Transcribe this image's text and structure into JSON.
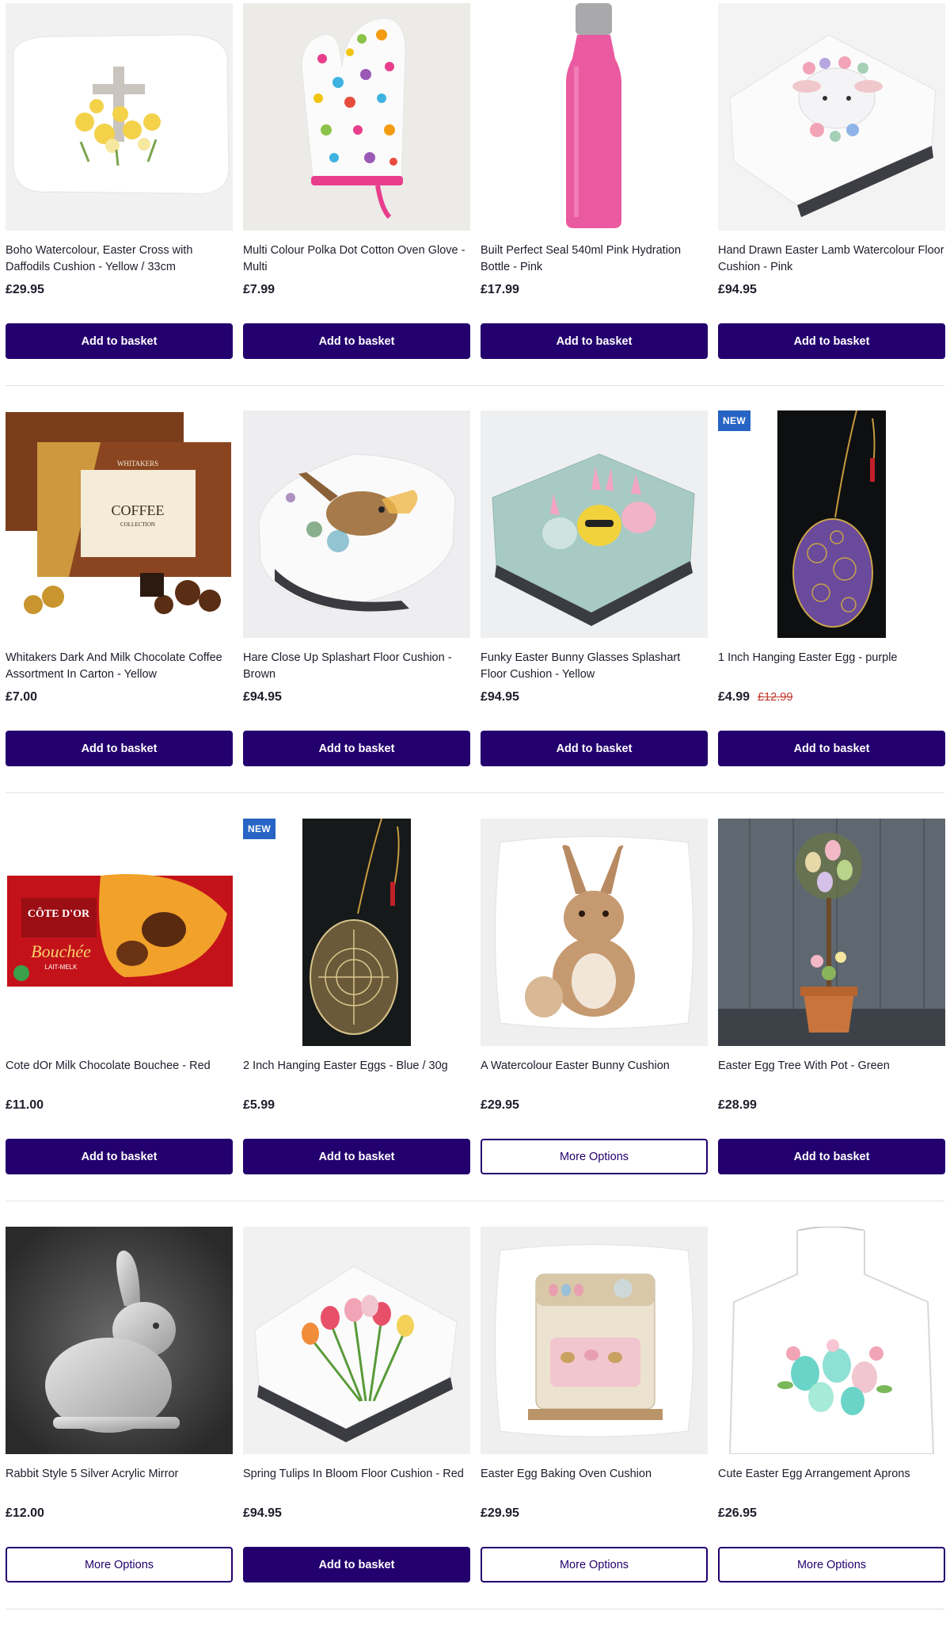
{
  "colors": {
    "primary_button": "#23006e",
    "new_badge": "#2764c4",
    "sale_price": "#c0392b",
    "divider": "#dfe3ea"
  },
  "rows": [
    {
      "products": [
        {
          "title": "Boho Watercolour, Easter Cross with Daffodils Cushion - Yellow / 33cm",
          "price": "£29.95",
          "was_price": null,
          "badge": null,
          "button": "Add to basket",
          "button_style": "primary",
          "image": "cross-daffodils-cushion"
        },
        {
          "title": "Multi Colour Polka Dot Cotton Oven Glove - Multi",
          "price": "£7.99",
          "was_price": null,
          "badge": null,
          "button": "Add to basket",
          "button_style": "primary",
          "image": "polka-dot-oven-glove"
        },
        {
          "title": "Built Perfect Seal 540ml Pink Hydration Bottle - Pink",
          "price": "£17.99",
          "was_price": null,
          "badge": null,
          "button": "Add to basket",
          "button_style": "primary",
          "image": "pink-hydration-bottle"
        },
        {
          "title": "Hand Drawn Easter Lamb Watercolour Floor Cushion - Pink",
          "price": "£94.95",
          "was_price": null,
          "badge": null,
          "button": "Add to basket",
          "button_style": "primary",
          "image": "lamb-floor-cushion"
        }
      ]
    },
    {
      "products": [
        {
          "title": "Whitakers Dark And Milk Chocolate Coffee Assortment In Carton - Yellow",
          "price": "£7.00",
          "was_price": null,
          "badge": null,
          "button": "Add to basket",
          "button_style": "primary",
          "image": "coffee-chocolate-box",
          "image_text": {
            "brand": "WHITAKERS",
            "product": "COFFEE",
            "sub": "COLLECTION"
          }
        },
        {
          "title": "Hare Close Up Splashart Floor Cushion - Brown",
          "price": "£94.95",
          "was_price": null,
          "badge": null,
          "button": "Add to basket",
          "button_style": "primary",
          "image": "hare-floor-cushion"
        },
        {
          "title": "Funky Easter Bunny Glasses Splashart Floor Cushion - Yellow",
          "price": "£94.95",
          "was_price": null,
          "badge": null,
          "button": "Add to basket",
          "button_style": "primary",
          "image": "bunny-glasses-cushion"
        },
        {
          "title": "1 Inch Hanging Easter Egg - purple",
          "price": "£4.99",
          "was_price": "£12.99",
          "badge": "NEW",
          "button": "Add to basket",
          "button_style": "primary",
          "image": "purple-hanging-egg"
        }
      ]
    },
    {
      "products": [
        {
          "title": "Cote dOr Milk Chocolate Bouchee - Red",
          "price": "£11.00",
          "was_price": null,
          "badge": null,
          "button": "Add to basket",
          "button_style": "primary",
          "image": "cote-dor-bouchee",
          "image_text": {
            "brand": "CÔTE D'OR",
            "product": "Bouchée",
            "sub": "LAIT-MELK"
          }
        },
        {
          "title": "2 Inch Hanging Easter Eggs - Blue / 30g",
          "price": "£5.99",
          "was_price": null,
          "badge": "NEW",
          "button": "Add to basket",
          "button_style": "primary",
          "image": "gold-hanging-egg"
        },
        {
          "title": "A Watercolour Easter Bunny Cushion",
          "price": "£29.95",
          "was_price": null,
          "badge": null,
          "button": "More Options",
          "button_style": "outline",
          "image": "bunny-cushion"
        },
        {
          "title": "Easter Egg Tree With Pot - Green",
          "price": "£28.99",
          "was_price": null,
          "badge": null,
          "button": "Add to basket",
          "button_style": "primary",
          "image": "egg-tree-pot"
        }
      ]
    },
    {
      "products": [
        {
          "title": "Rabbit Style 5 Silver Acrylic Mirror",
          "price": "£12.00",
          "was_price": null,
          "badge": null,
          "button": "More Options",
          "button_style": "outline",
          "image": "rabbit-mirror"
        },
        {
          "title": "Spring Tulips In Bloom Floor Cushion - Red",
          "price": "£94.95",
          "was_price": null,
          "badge": null,
          "button": "Add to basket",
          "button_style": "primary",
          "image": "tulips-cushion"
        },
        {
          "title": "Easter Egg Baking Oven Cushion",
          "price": "£29.95",
          "was_price": null,
          "badge": null,
          "button": "More Options",
          "button_style": "outline",
          "image": "oven-cushion"
        },
        {
          "title": "Cute Easter Egg Arrangement Aprons",
          "price": "£26.95",
          "was_price": null,
          "badge": null,
          "button": "More Options",
          "button_style": "outline",
          "image": "easter-apron"
        }
      ]
    }
  ]
}
